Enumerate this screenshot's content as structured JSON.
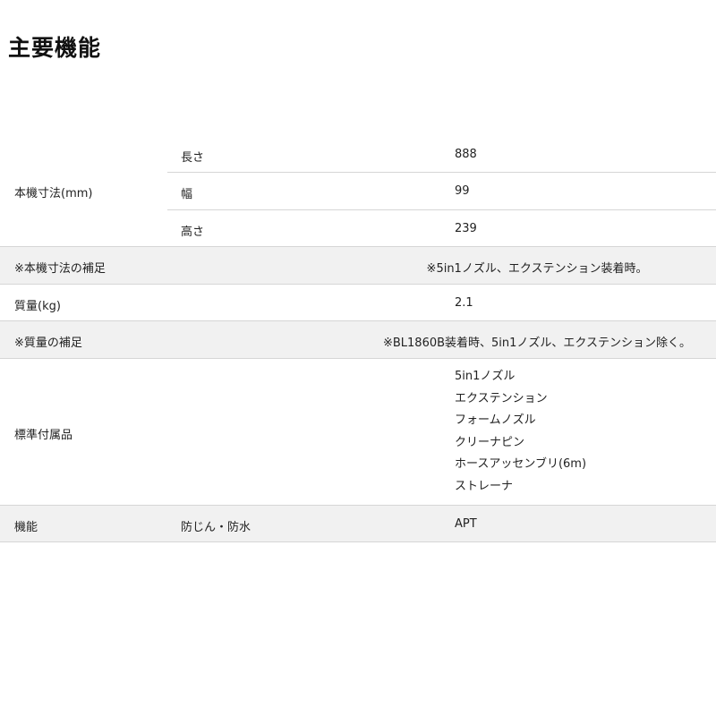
{
  "page_title": "主要機能",
  "dims": {
    "label": "本機寸法(mm)",
    "rows": [
      {
        "name": "長さ",
        "value": "888"
      },
      {
        "name": "幅",
        "value": "99"
      },
      {
        "name": "高さ",
        "value": "239"
      }
    ]
  },
  "dims_note": {
    "label": "※本機寸法の補足",
    "value": "※5in1ノズル、エクステンション装着時。"
  },
  "mass": {
    "label": "質量(kg)",
    "value": "2.1"
  },
  "mass_note": {
    "label": "※質量の補足",
    "value": "※BL1860B装着時、5in1ノズル、エクステンション除く。"
  },
  "accessories": {
    "label": "標準付属品",
    "items": [
      "5in1ノズル",
      "エクステンション",
      "フォームノズル",
      "クリーナピン",
      "ホースアッセンブリ(6m)",
      "ストレーナ"
    ]
  },
  "function": {
    "label": "機能",
    "sub": "防じん・防水",
    "value": "APT"
  }
}
